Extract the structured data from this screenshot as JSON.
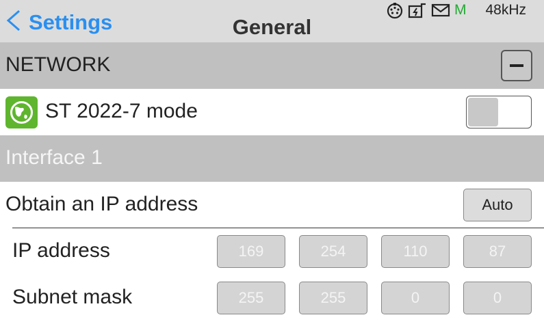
{
  "header": {
    "back_label": "Settings",
    "title": "General",
    "status": {
      "icons": [
        "midi-icon",
        "battery-icon",
        "mail-icon"
      ],
      "m_label": "M",
      "sample_rate": "48kHz"
    }
  },
  "network": {
    "section_title": "NETWORK",
    "collapse_symbol": "minus",
    "mode_label": "ST 2022-7 mode",
    "mode_enabled": false
  },
  "interface": {
    "title": "Interface 1",
    "obtain_label": "Obtain an IP address",
    "obtain_value": "Auto",
    "ip_label": "IP address",
    "ip": [
      "169",
      "254",
      "110",
      "87"
    ],
    "mask_label": "Subnet mask",
    "mask": [
      "255",
      "255",
      "0",
      "0"
    ]
  },
  "colors": {
    "accent": "#2a8ff0",
    "header_bg": "#dcdcdc",
    "section_bg": "#c0c0c0",
    "status_m": "#22aa33",
    "globe_green": "#5fb52e"
  }
}
